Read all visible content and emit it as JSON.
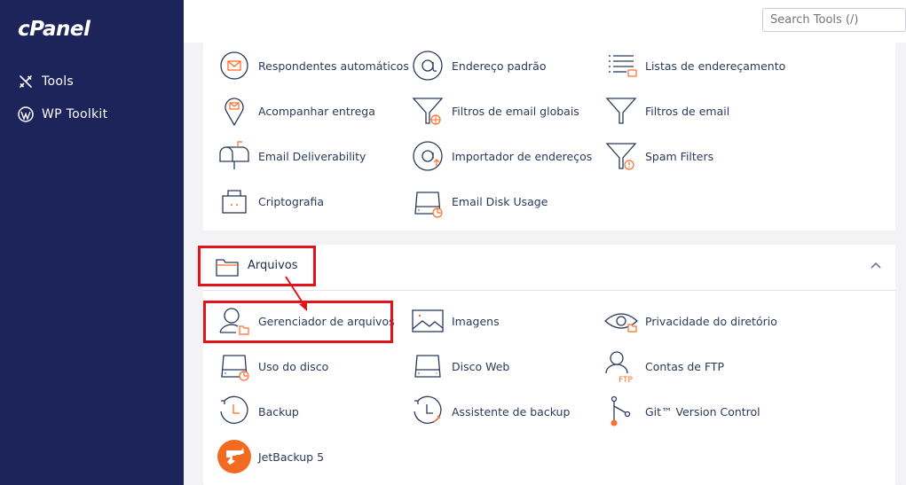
{
  "sidebar": {
    "logo": "cPanel",
    "items": [
      {
        "label": "Tools",
        "icon": "tools-icon"
      },
      {
        "label": "WP Toolkit",
        "icon": "wordpress-icon"
      }
    ]
  },
  "search": {
    "placeholder": "Search Tools (/)"
  },
  "email_tools": [
    {
      "label": "Respondentes automáticos",
      "icon": "autoresponder-icon"
    },
    {
      "label": "Endereço padrão",
      "icon": "at-sign-icon"
    },
    {
      "label": "Listas de endereçamento",
      "icon": "mailing-list-icon"
    },
    {
      "label": "Acompanhar entrega",
      "icon": "track-delivery-icon"
    },
    {
      "label": "Filtros de email globais",
      "icon": "global-filter-icon"
    },
    {
      "label": "Filtros de email",
      "icon": "filter-icon"
    },
    {
      "label": "Email Deliverability",
      "icon": "mailbox-icon"
    },
    {
      "label": "Importador de endereços",
      "icon": "address-importer-icon"
    },
    {
      "label": "Spam Filters",
      "icon": "spam-filter-icon"
    },
    {
      "label": "Criptografia",
      "icon": "encryption-icon"
    },
    {
      "label": "Email Disk Usage",
      "icon": "disk-usage-icon"
    }
  ],
  "files_section": {
    "title": "Arquivos",
    "tools": [
      {
        "label": "Gerenciador de arquivos",
        "icon": "file-manager-icon"
      },
      {
        "label": "Imagens",
        "icon": "images-icon"
      },
      {
        "label": "Privacidade do diretório",
        "icon": "directory-privacy-icon"
      },
      {
        "label": "Uso do disco",
        "icon": "disk-usage-icon"
      },
      {
        "label": "Disco Web",
        "icon": "web-disk-icon"
      },
      {
        "label": "Contas de FTP",
        "icon": "ftp-accounts-icon"
      },
      {
        "label": "Backup",
        "icon": "backup-icon"
      },
      {
        "label": "Assistente de backup",
        "icon": "backup-wizard-icon"
      },
      {
        "label": "Git™ Version Control",
        "icon": "git-icon"
      },
      {
        "label": "JetBackup 5",
        "icon": "jetbackup-icon"
      }
    ]
  },
  "colors": {
    "sidebar": "#1c2459",
    "accent": "#ff6c2c",
    "highlight": "#e1141c"
  }
}
